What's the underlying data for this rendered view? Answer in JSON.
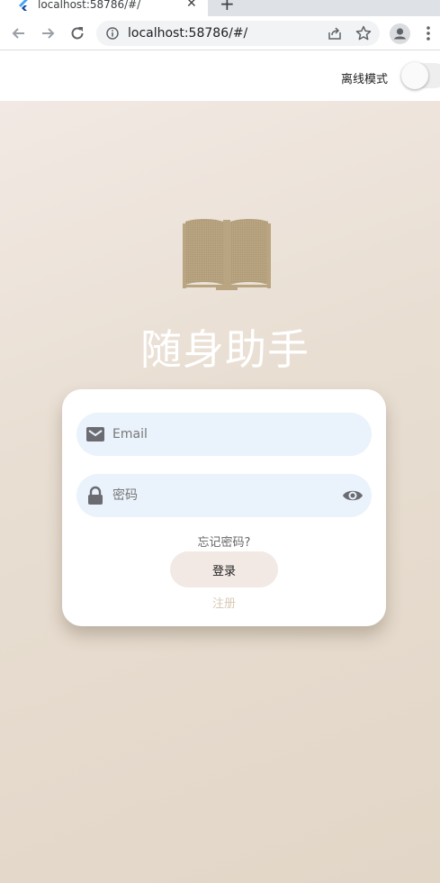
{
  "browser": {
    "tab_title": "localhost:58786/#/",
    "tab_close": "✕",
    "new_tab": "+",
    "url": "localhost:58786/#/"
  },
  "app_bar": {
    "offline_label": "离线模式",
    "offline_enabled": false
  },
  "hero": {
    "app_title": "随身助手",
    "icon": "book-icon"
  },
  "login_form": {
    "email_placeholder": "Email",
    "email_value": "",
    "password_placeholder": "密码",
    "password_value": "",
    "forgot_label": "忘记密码?",
    "login_label": "登录",
    "register_label": "注册"
  },
  "colors": {
    "accent_tan": "#b9a582",
    "field_bg": "#eaf2fb",
    "login_button_bg": "#f2e9e4",
    "register_text": "#d9c9b8"
  }
}
